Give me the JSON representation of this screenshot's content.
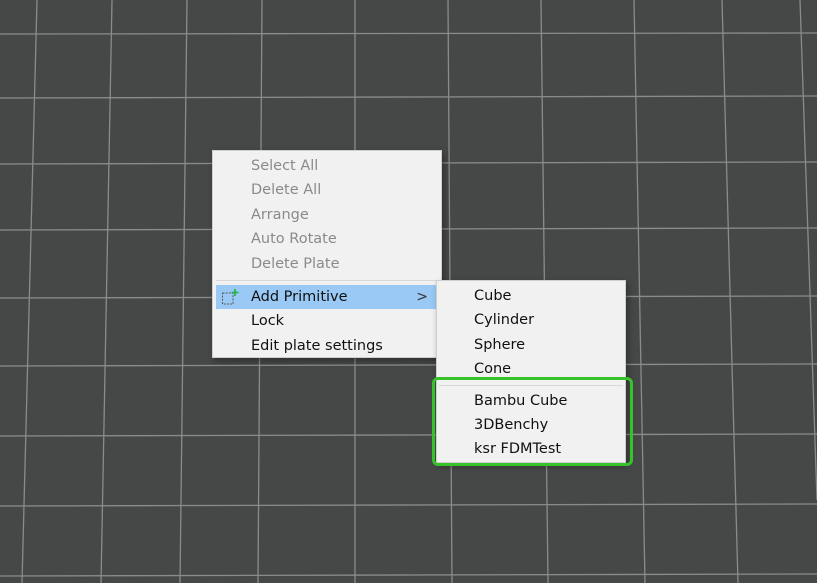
{
  "main_menu": {
    "items": [
      {
        "label": "Select All"
      },
      {
        "label": "Delete All"
      },
      {
        "label": "Arrange"
      },
      {
        "label": "Auto Rotate"
      },
      {
        "label": "Delete Plate"
      }
    ],
    "add_primitive": {
      "label": "Add Primitive",
      "arrow": ">",
      "icon": "add-object-icon"
    },
    "lock": {
      "label": "Lock"
    },
    "edit_plate": {
      "label": "Edit plate settings"
    }
  },
  "sub_menu": {
    "basic": [
      {
        "label": "Cube"
      },
      {
        "label": "Cylinder"
      },
      {
        "label": "Sphere"
      },
      {
        "label": "Cone"
      }
    ],
    "models": [
      {
        "label": "Bambu Cube"
      },
      {
        "label": "3DBenchy"
      },
      {
        "label": "ksr FDMTest"
      }
    ]
  },
  "colors": {
    "background": "#464847",
    "grid_line": "#8a8c8b",
    "menu_bg": "#f1f1f1",
    "highlight": "#99c9f4",
    "annotation_box": "#37c22a",
    "icon_plus": "#22b04a"
  }
}
